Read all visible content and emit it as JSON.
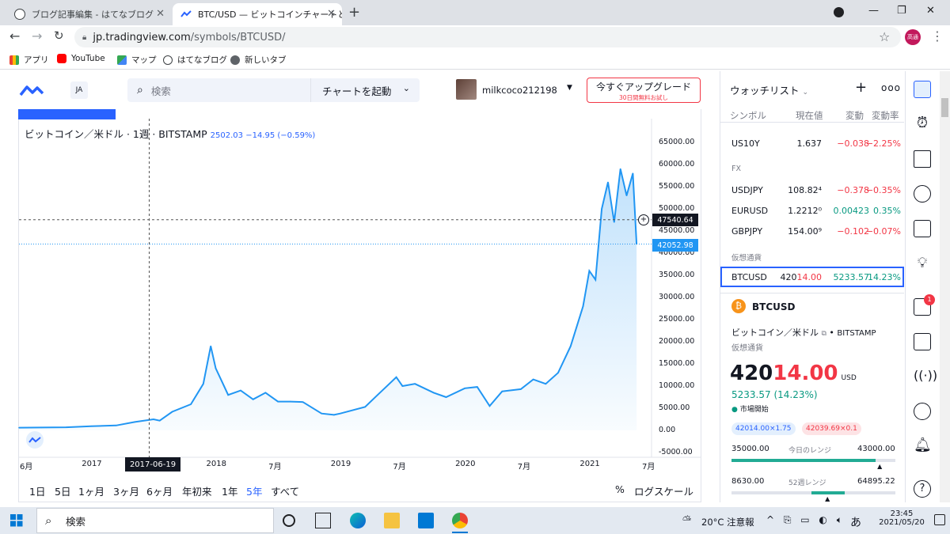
{
  "browser": {
    "tabs": [
      {
        "title": "ブログ記事編集 - はてなブログ",
        "active": false
      },
      {
        "title": "BTC/USD — ビットコインチャートと価",
        "active": true
      }
    ],
    "url_host": "jp.tradingview.com",
    "url_path": "/symbols/BTCUSD/",
    "profile_label": "高通",
    "bookmarks": [
      "アプリ",
      "YouTube",
      "マップ",
      "はてなブログ",
      "新しいタブ"
    ]
  },
  "header": {
    "lang": "JA",
    "search_placeholder": "検索",
    "launch_chart": "チャートを起動",
    "username": "milkcoco212198",
    "upgrade_title": "今すぐアップグレード",
    "upgrade_sub": "30日間無料お試し"
  },
  "chart": {
    "legend_name": "ビットコイン／米ドル · 1週 · BITSTAMP",
    "legend_change": "2502.03 −14.95 (−0.59%)",
    "crosshair_date": "2017-06-19",
    "crosshair_price": "47540.64",
    "last_price": "42052.98",
    "periods": [
      "1日",
      "5日",
      "1ヶ月",
      "3ヶ月",
      "6ヶ月",
      "年初来",
      "1年",
      "5年",
      "すべて"
    ],
    "active_period": "5年",
    "percent_label": "%",
    "log_label": "ログスケール"
  },
  "chart_data": {
    "type": "area",
    "title": "ビットコイン／米ドル · 1週 · BITSTAMP",
    "x": [
      2016.42,
      2016.6,
      2016.8,
      2017.0,
      2017.2,
      2017.35,
      2017.5,
      2017.55,
      2017.65,
      2017.8,
      2017.9,
      2017.96,
      2018.0,
      2018.05,
      2018.1,
      2018.2,
      2018.3,
      2018.4,
      2018.5,
      2018.6,
      2018.7,
      2018.85,
      2018.95,
      2019.0,
      2019.2,
      2019.3,
      2019.45,
      2019.5,
      2019.6,
      2019.75,
      2019.85,
      2020.0,
      2020.1,
      2020.2,
      2020.3,
      2020.45,
      2020.55,
      2020.65,
      2020.75,
      2020.85,
      2020.95,
      2021.0,
      2021.05,
      2021.1,
      2021.15,
      2021.2,
      2021.25,
      2021.3,
      2021.35,
      2021.38
    ],
    "y": [
      600,
      650,
      700,
      950,
      1100,
      1900,
      2500,
      2200,
      4200,
      5900,
      10500,
      19000,
      14000,
      11000,
      8000,
      9000,
      7000,
      8500,
      6500,
      6500,
      6400,
      3800,
      3500,
      3800,
      5300,
      8000,
      12000,
      10000,
      10500,
      8500,
      7500,
      9500,
      9800,
      5500,
      8800,
      9300,
      11500,
      10500,
      13000,
      19000,
      28000,
      36000,
      34000,
      50000,
      56000,
      47000,
      59000,
      53000,
      58000,
      42052
    ],
    "xlim": [
      2016.42,
      2021.5
    ],
    "ylim": [
      -5000,
      65000
    ],
    "yticks": [
      "65000.00",
      "60000.00",
      "55000.00",
      "50000.00",
      "45000.00",
      "40000.00",
      "35000.00",
      "30000.00",
      "25000.00",
      "20000.00",
      "15000.00",
      "10000.00",
      "5000.00",
      "0.00",
      "-5000.00"
    ],
    "xticks": [
      "6月",
      "2017",
      "2018",
      "7月",
      "2019",
      "7月",
      "2020",
      "7月",
      "2021",
      "7月"
    ],
    "grid": false,
    "color": "#2196f3"
  },
  "watchlist": {
    "title": "ウォッチリスト",
    "col_symbol": "シンボル",
    "col_last": "現在値",
    "col_chg": "変動",
    "col_pct": "変動率",
    "rows_top": [
      {
        "sym": "US10Y",
        "last": "1.637",
        "chg": "−0.038",
        "pct": "−2.25%",
        "dir": "down"
      }
    ],
    "section_fx": "FX",
    "rows_fx": [
      {
        "sym": "USDJPY",
        "last": "108.82⁴",
        "chg": "−0.378",
        "pct": "−0.35%",
        "dir": "down"
      },
      {
        "sym": "EURUSD",
        "last": "1.2212⁰",
        "chg": "0.00423",
        "pct": "0.35%",
        "dir": "up"
      },
      {
        "sym": "GBPJPY",
        "last": "154.00⁹",
        "chg": "−0.102",
        "pct": "−0.07%",
        "dir": "down"
      }
    ],
    "section_crypto": "仮想通貨",
    "rows_crypto": [
      {
        "sym": "BTCUSD",
        "last_a": "420",
        "last_b": "14.00",
        "chg": "5233.57",
        "pct": "14.23%",
        "dir": "up"
      }
    ]
  },
  "details": {
    "symbol": "BTCUSD",
    "name": "ビットコイン／米ドル",
    "exchange": "BITSTAMP",
    "category": "仮想通貨",
    "price_a": "420",
    "price_b": "14.00",
    "currency": "USD",
    "change": "5233.57 (14.23%)",
    "market_status": "市場開始",
    "bid": "42014.00×1.75",
    "ask": "42039.69×0.1",
    "day_low": "35000.00",
    "day_label": "今日のレンジ",
    "day_high": "43000.00",
    "day_progress": 0.88,
    "wk_low": "8630.00",
    "wk_label": "52週レンジ",
    "wk_high": "64895.22",
    "wk_progress": 0.59
  },
  "notif_count": "1",
  "taskbar": {
    "search": "検索",
    "weather": "20°C 注意報",
    "ime": "あ",
    "time": "23:45",
    "date": "2021/05/20"
  }
}
